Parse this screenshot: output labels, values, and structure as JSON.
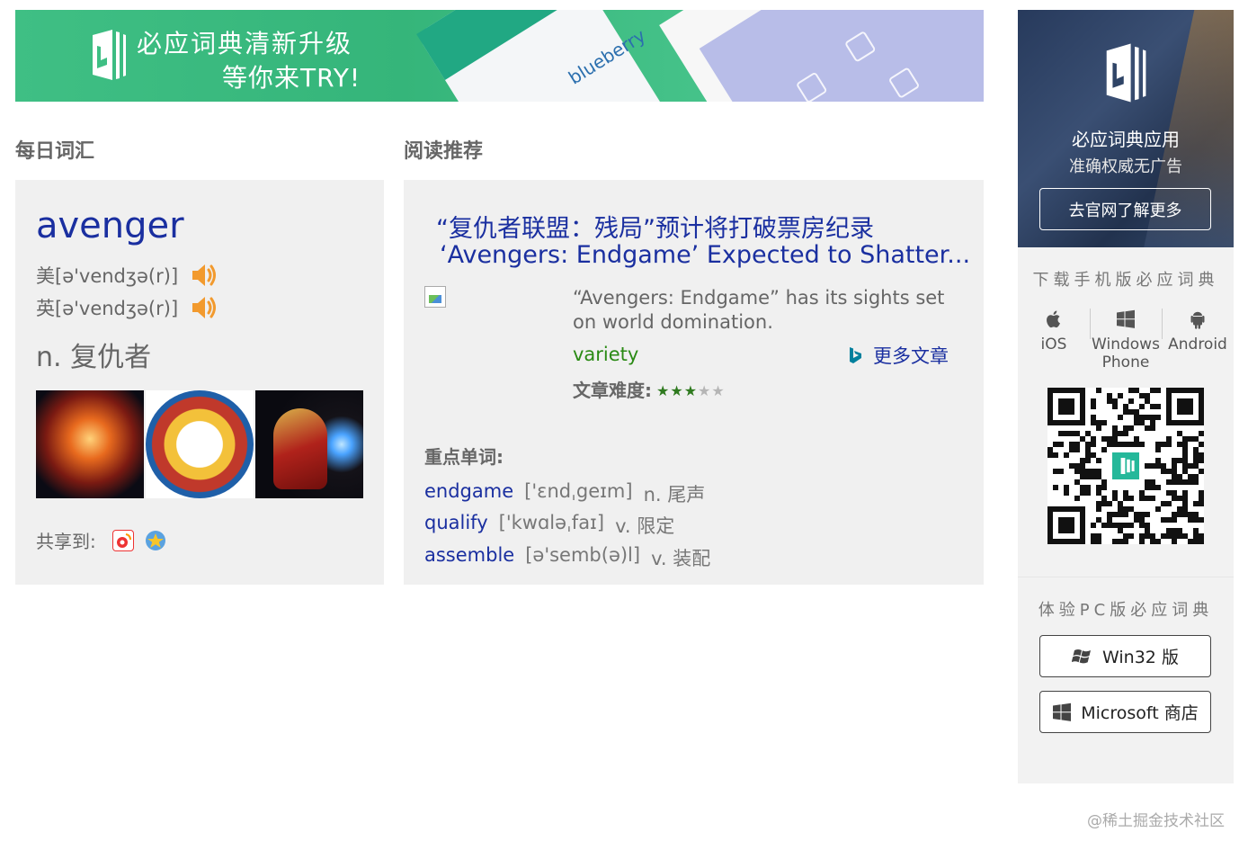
{
  "banner": {
    "slogan_line1": "必应词典清新升级",
    "slogan_line2": "等你来TRY!",
    "card_word": "blueberry"
  },
  "daily_words": {
    "heading": "每日词汇",
    "word": "avenger",
    "pron_us": "美[ə'vendʒə(r)]",
    "pron_uk": "英[ə'vendʒə(r)]",
    "definition": "n. 复仇者",
    "share_label": "共享到:"
  },
  "reading": {
    "heading": "阅读推荐",
    "title_cn": "“复仇者联盟：残局”预计将打破票房纪录",
    "title_en": "‘Avengers: Endgame’  Expected to Shatter...",
    "description": "“Avengers: Endgame”  has its sights set on world domination.",
    "source": "variety",
    "more_label": "更多文章",
    "difficulty_label": "文章难度:",
    "difficulty": {
      "filled": 3,
      "total": 5
    },
    "keywords_heading": "重点单词:",
    "keywords": [
      {
        "word": "endgame",
        "pron": "['ɛndˌgeɪm]",
        "def": "n. 尾声"
      },
      {
        "word": "qualify",
        "pron": "['kwɑləˌfaɪ]",
        "def": "v. 限定"
      },
      {
        "word": "assemble",
        "pron": "[ə'semb(ə)l]",
        "def": "v. 装配"
      }
    ]
  },
  "sidebar": {
    "app_name": "必应词典应用",
    "app_tagline": "准确权威无广告",
    "learn_more": "去官网了解更多",
    "mobile_heading": "下载手机版必应词典",
    "platforms": [
      {
        "line1": "iOS",
        "line2": ""
      },
      {
        "line1": "Windows",
        "line2": "Phone"
      },
      {
        "line1": "Android",
        "line2": ""
      }
    ],
    "pc_heading": "体验PC版必应词典",
    "win32_label": "Win32 版",
    "store_label": "Microsoft 商店"
  },
  "watermark": "@稀土掘金技术社区",
  "colors": {
    "brand_green": "#3fbf84",
    "link_blue": "#1a2fa0",
    "source_green": "#2a8a14",
    "star_filled": "#2f7a1f",
    "star_empty": "#b5b5b5",
    "card_bg": "#f0f0f0"
  }
}
